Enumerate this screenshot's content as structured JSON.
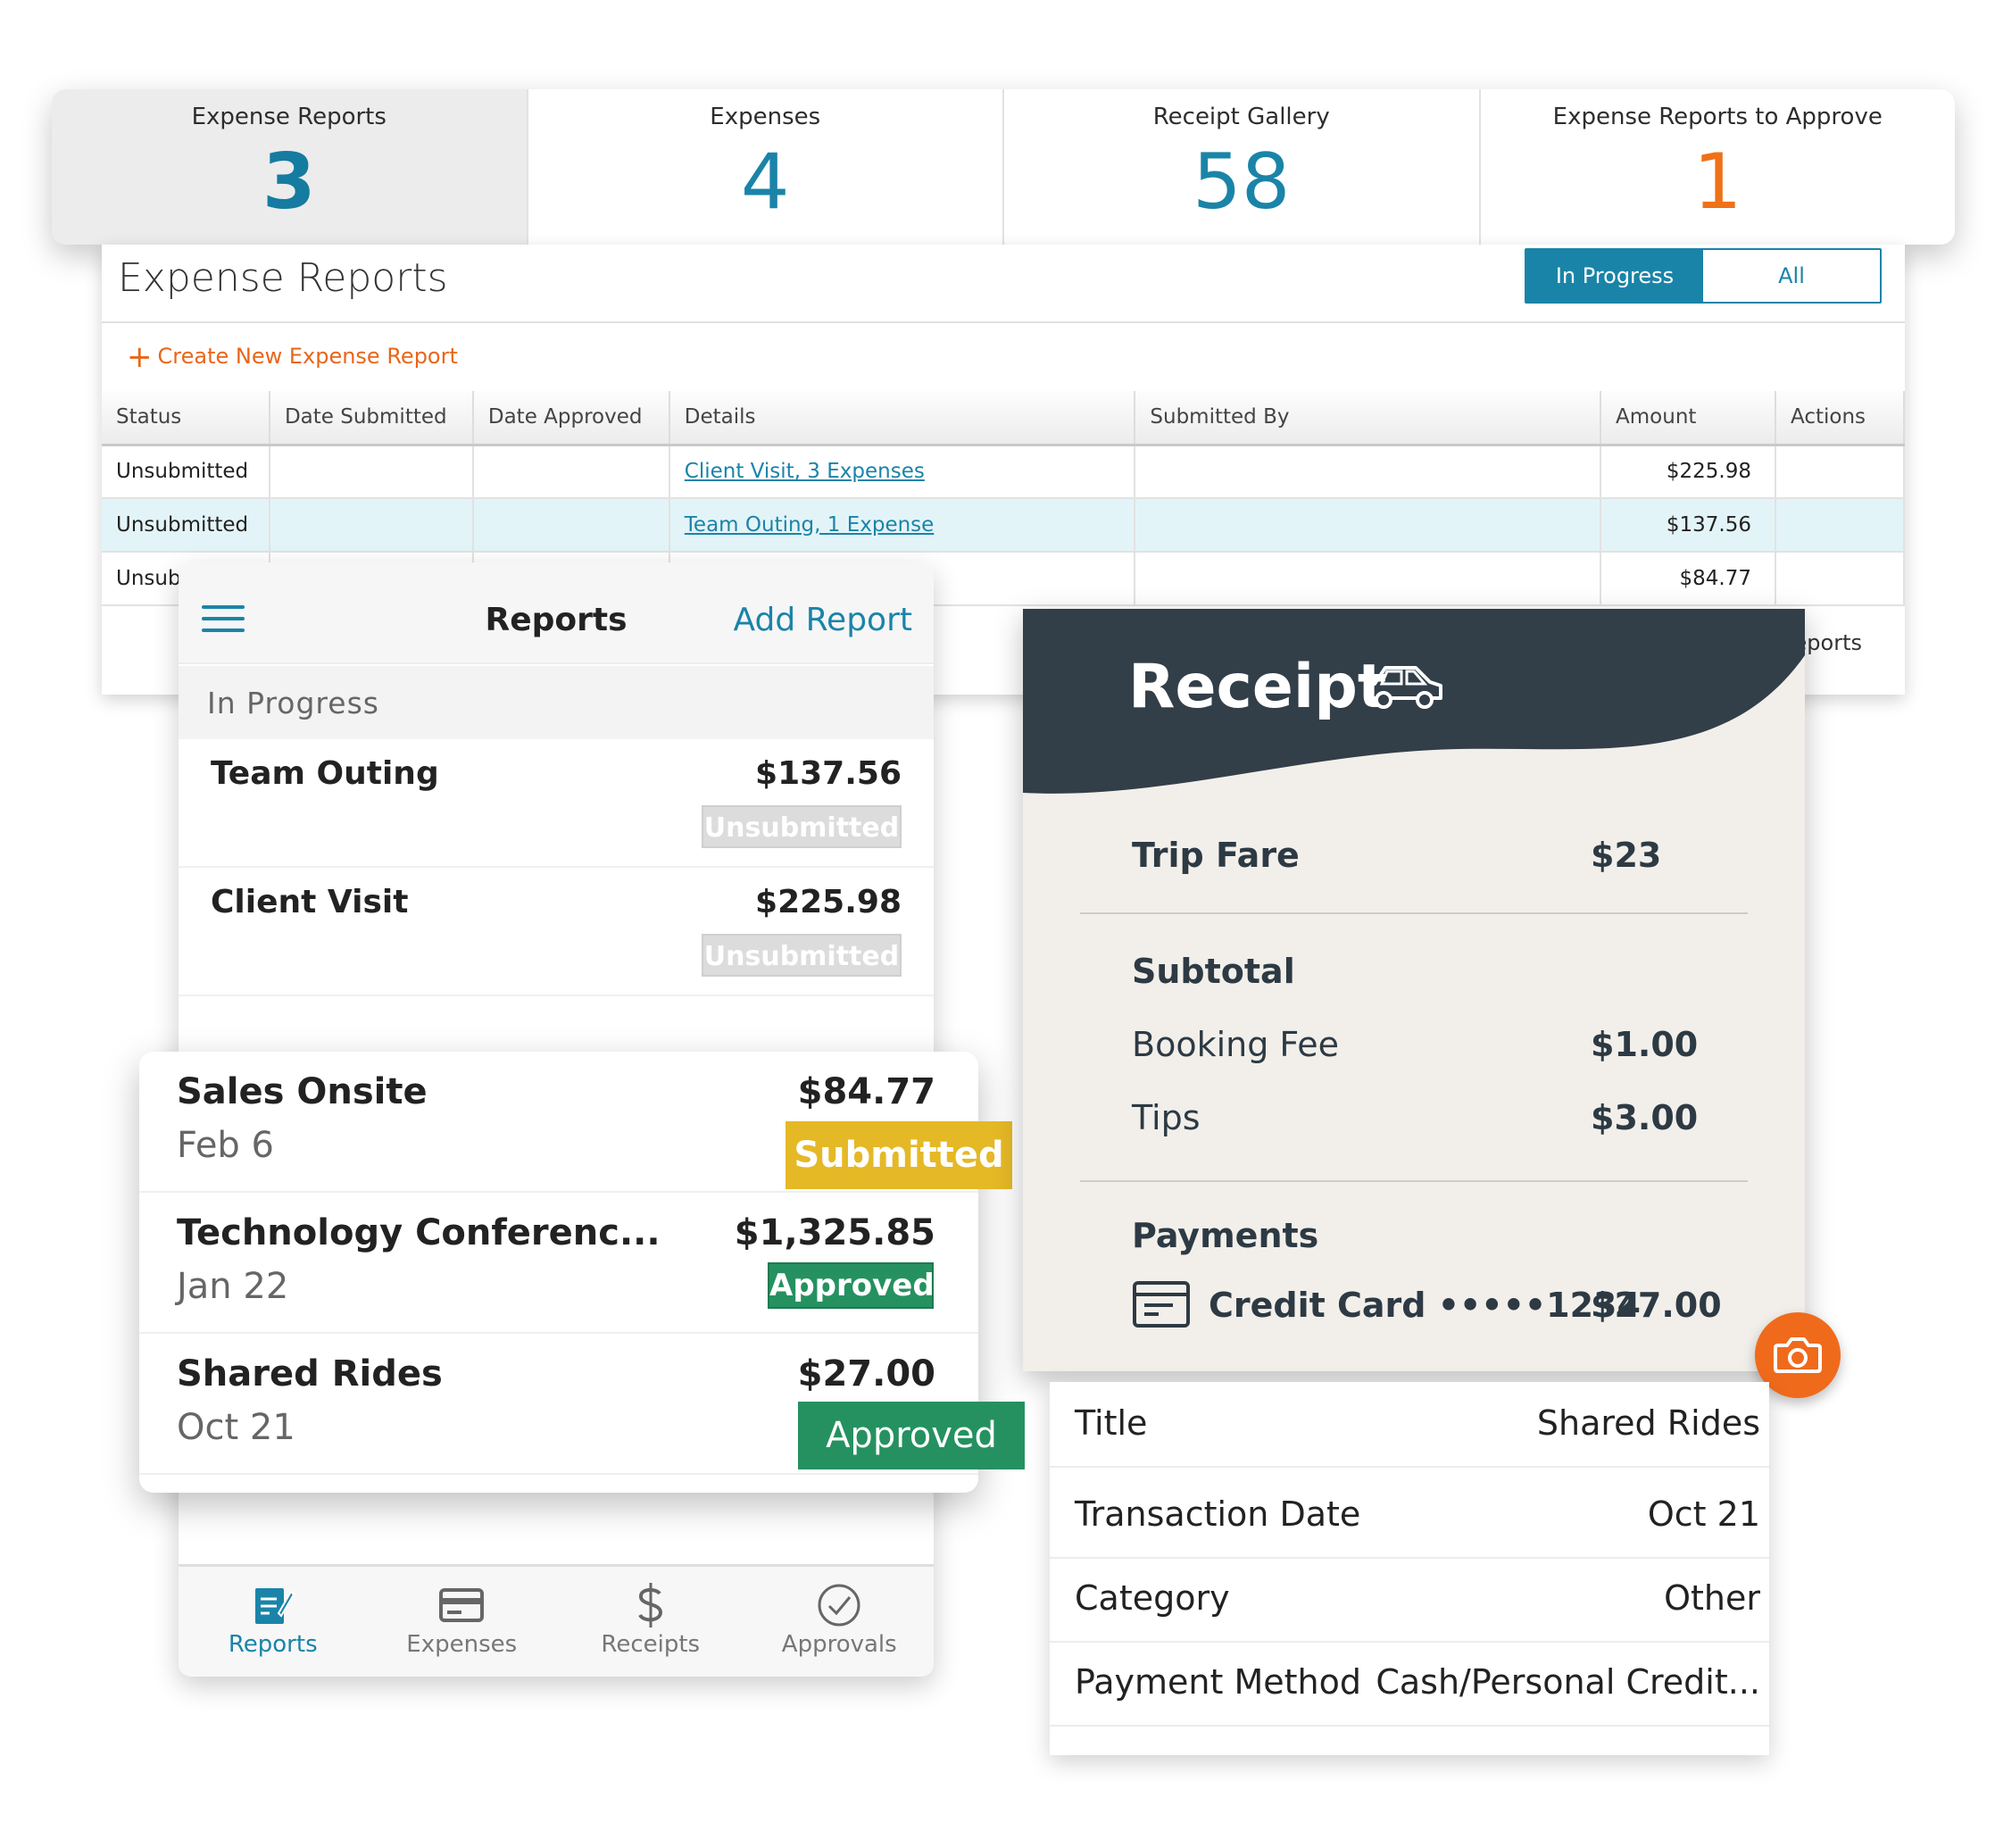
{
  "summary": [
    {
      "label": "Expense Reports",
      "value": "3"
    },
    {
      "label": "Expenses",
      "value": "4"
    },
    {
      "label": "Receipt Gallery",
      "value": "58"
    },
    {
      "label": "Expense Reports to Approve",
      "value": "1"
    }
  ],
  "desktop": {
    "title": "Expense Reports",
    "filters": [
      "In Progress",
      "All"
    ],
    "create_label": "Create New Expense Report",
    "columns": [
      "Status",
      "Date Submitted",
      "Date Approved",
      "Details",
      "Submitted By",
      "Amount",
      "Actions"
    ],
    "rows": [
      {
        "status": "Unsubmitted",
        "details": "Client Visit, 3 Expenses",
        "amount": "$225.98"
      },
      {
        "status": "Unsubmitted",
        "details": "Team Outing, 1 Expense",
        "amount": "$137.56"
      },
      {
        "status": "Unsub",
        "details": "",
        "amount": "$84.77"
      }
    ],
    "footer_text": "eports"
  },
  "mobile": {
    "title": "Reports",
    "add_label": "Add Report",
    "section": "In Progress",
    "items": [
      {
        "name": "Team Outing",
        "amount": "$137.56",
        "status": "Unsubmitted"
      },
      {
        "name": "Client Visit",
        "amount": "$225.98",
        "status": "Unsubmitted"
      }
    ],
    "tabs": [
      "Reports",
      "Expenses",
      "Receipts",
      "Approvals"
    ]
  },
  "overlay": [
    {
      "name": "Sales Onsite",
      "date": "Feb 6",
      "amount": "$84.77",
      "status": "Submitted"
    },
    {
      "name": "Technology Conferenc...",
      "date": "Jan 22",
      "amount": "$1,325.85",
      "status": "Approved"
    },
    {
      "name": "Shared Rides",
      "date": "Oct 21",
      "amount": "$27.00",
      "status": "Approved"
    }
  ],
  "receipt": {
    "title": "Receipt",
    "trip_fare_label": "Trip Fare",
    "trip_fare": "$23",
    "subtotal_label": "Subtotal",
    "booking_fee_label": "Booking Fee",
    "booking_fee": "$1.00",
    "tips_label": "Tips",
    "tips": "$3.00",
    "payments_label": "Payments",
    "card_label": "Credit Card •••••1234",
    "card_amount": "$27.00"
  },
  "detail": [
    {
      "key": "Title",
      "value": "Shared Rides"
    },
    {
      "key": "Transaction Date",
      "value": "Oct 21"
    },
    {
      "key": "Category",
      "value": "Other"
    },
    {
      "key": "Payment Method",
      "value": "Cash/Personal Credit..."
    }
  ],
  "colors": {
    "accent": "#1a84a8",
    "orange": "#ef7118",
    "submitted": "#e5b826",
    "approved": "#259160",
    "receipt_header": "#323e48"
  }
}
